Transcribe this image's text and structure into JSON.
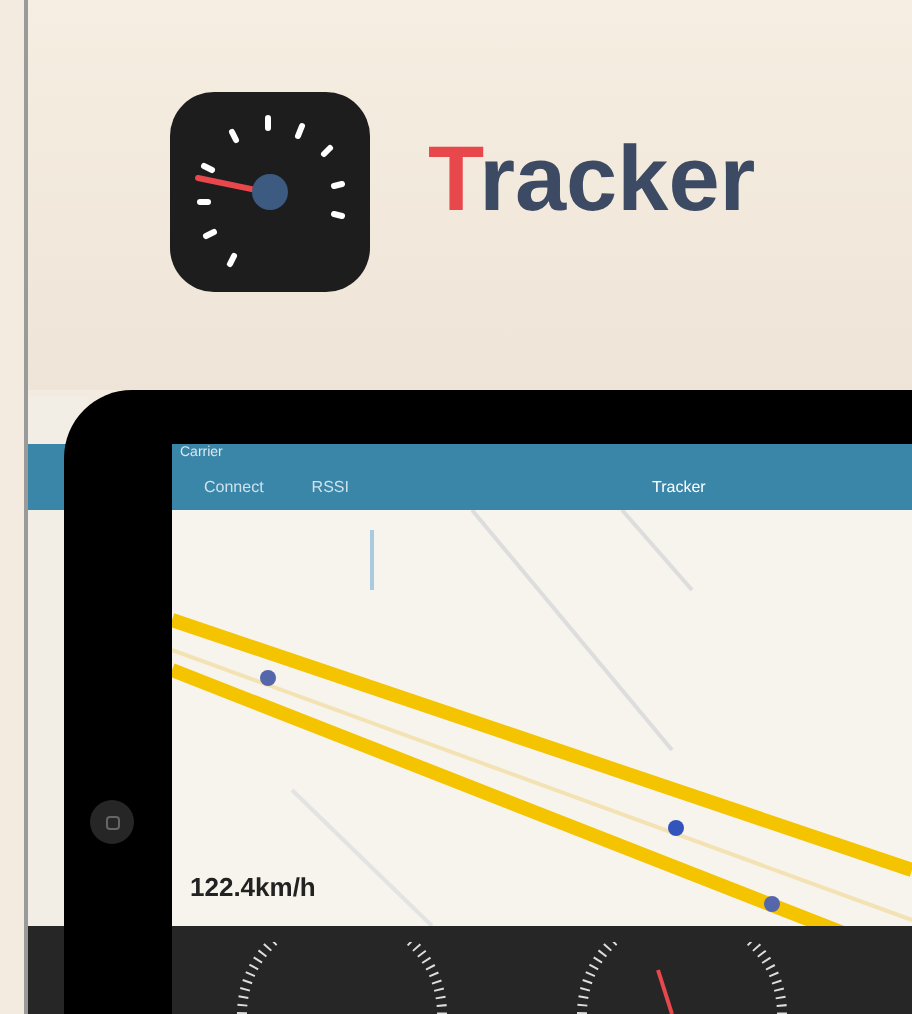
{
  "banner": {
    "title": "Tracker"
  },
  "tablet": {
    "status_bar": {
      "carrier": "Carrier"
    },
    "nav_bar": {
      "buttons": [
        "Connect",
        "RSSI"
      ],
      "title": "Tracker"
    },
    "speed": "122.4km/h"
  }
}
